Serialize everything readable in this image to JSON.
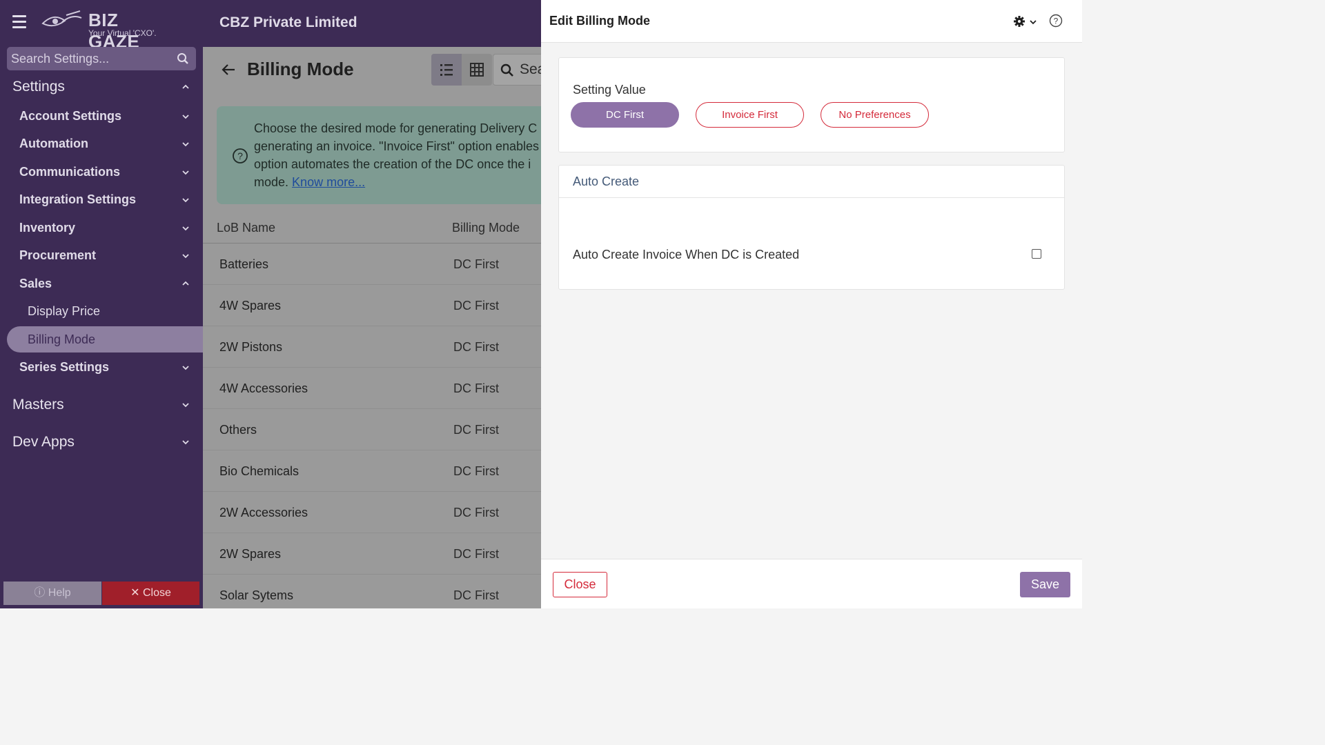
{
  "app": {
    "logo_text": "BIZ GAZE",
    "logo_sub": "Your Virtual 'CXO'.",
    "company": "CBZ Private Limited"
  },
  "sidebar": {
    "search_placeholder": "Search Settings...",
    "settings_label": "Settings",
    "items": [
      {
        "label": "Account Settings"
      },
      {
        "label": "Automation"
      },
      {
        "label": "Communications"
      },
      {
        "label": "Integration Settings"
      },
      {
        "label": "Inventory"
      },
      {
        "label": "Procurement"
      },
      {
        "label": "Sales"
      },
      {
        "label": "Series Settings"
      }
    ],
    "sales_sub": [
      {
        "label": "Display Price"
      },
      {
        "label": "Billing Mode"
      }
    ],
    "masters_label": "Masters",
    "devapps_label": "Dev Apps",
    "help_label": "Help",
    "close_label": "Close"
  },
  "main": {
    "title": "Billing Mode",
    "search_text": "Sea",
    "info_lines": [
      "Choose the desired mode for generating Delivery C",
      "generating an invoice. \"Invoice First\" option enables",
      "option automates the creation of the DC once the i",
      "mode."
    ],
    "info_link": "Know more...",
    "columns": [
      "LoB Name",
      "Billing Mode"
    ],
    "rows": [
      {
        "name": "Batteries",
        "mode": "DC First"
      },
      {
        "name": "4W Spares",
        "mode": "DC First"
      },
      {
        "name": "2W Pistons",
        "mode": "DC First"
      },
      {
        "name": "4W Accessories",
        "mode": "DC First"
      },
      {
        "name": "Others",
        "mode": "DC First"
      },
      {
        "name": "Bio Chemicals",
        "mode": "DC First"
      },
      {
        "name": "2W Accessories",
        "mode": "DC First"
      },
      {
        "name": "2W Spares",
        "mode": "DC First"
      },
      {
        "name": "Solar Sytems",
        "mode": "DC First"
      }
    ]
  },
  "panel": {
    "title": "Edit Billing Mode",
    "setting_value_label": "Setting Value",
    "options": [
      "DC First",
      "Invoice First",
      "No Preferences"
    ],
    "selected_option": "DC First",
    "auto_create_title": "Auto Create",
    "auto_create_label": "Auto Create Invoice When DC is Created",
    "auto_create_checked": false,
    "close_label": "Close",
    "save_label": "Save"
  },
  "colors": {
    "sidebar_bg": "#3d2b55",
    "accent": "#8e72a8",
    "danger": "#d42a3a"
  }
}
